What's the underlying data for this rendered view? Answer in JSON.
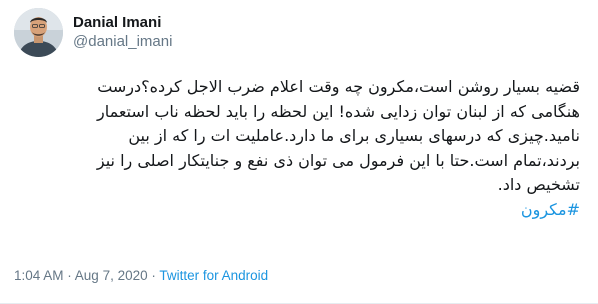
{
  "author": {
    "display_name": "Danial Imani",
    "handle": "@danial_imani"
  },
  "tweet": {
    "lines": [
      "قضیه بسیار روشن است،مکرون چه وقت اعلام ضرب الاجل کرده؟درست",
      "هنگامی که از لبنان توان زدایی شده! این لحظه را باید لحظه ناب استعمار",
      "نامید.چیزی که درسهای بسیاری برای ما دارد.عاملیت ات را که از بین",
      "بردند،تمام است.حتا با این فرمول می توان ذی نفع و جنایتکار اصلی را نیز",
      "تشخیص داد."
    ],
    "hashtag": "#مکرون"
  },
  "meta": {
    "time": "1:04 AM",
    "separator1": " · ",
    "date": "Aug 7, 2020",
    "separator2": " · ",
    "source": "Twitter for Android"
  },
  "colors": {
    "link": "#1b95e0",
    "secondary_text": "#657786",
    "primary_text": "#14171a"
  }
}
